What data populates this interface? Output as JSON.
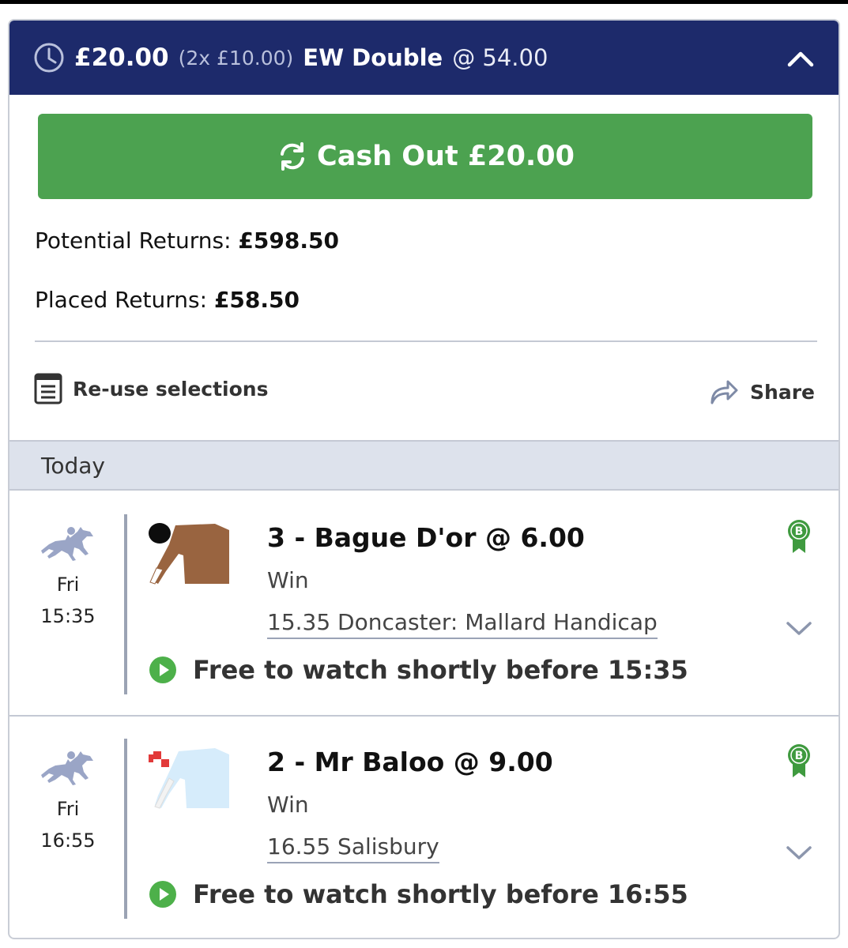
{
  "bet": {
    "stake": "£20.00",
    "split": "(2x £10.00)",
    "bet_type": "EW Double",
    "odds": "@ 54.00"
  },
  "cashout": {
    "label": "Cash Out £20.00"
  },
  "returns": {
    "potential_label": "Potential Returns: ",
    "potential_value": "£598.50",
    "placed_label": "Placed Returns: ",
    "placed_value": "£58.50"
  },
  "actions": {
    "reuse_label": "Re-use selections",
    "share_label": "Share"
  },
  "section_label": "Today",
  "selections": [
    {
      "day": "Fri",
      "time": "15:35",
      "title": "3 - Bague D'or @ 6.00",
      "market": "Win",
      "event": "15.35 Doncaster: Mallard Handicap",
      "watch": "Free to watch shortly before 15:35",
      "badge": "B"
    },
    {
      "day": "Fri",
      "time": "16:55",
      "title": "2 - Mr Baloo @ 9.00",
      "market": "Win",
      "event": "16.55 Salisbury",
      "watch": "Free to watch shortly before 16:55",
      "badge": "B"
    }
  ],
  "colors": {
    "header_bg": "#1d2a6b",
    "cashout_green": "#4ca250",
    "play_green": "#4db04a",
    "section_bg": "#dde2ec"
  },
  "icons": {
    "header": "clock-icon",
    "collapse": "chevron-up-icon",
    "cashout": "refresh-icon",
    "reuse": "list-icon",
    "share": "share-arrow-icon",
    "sport": "horse-racing-icon",
    "badge": "boost-ribbon-icon",
    "expand": "chevron-down-icon",
    "watch": "play-icon"
  }
}
